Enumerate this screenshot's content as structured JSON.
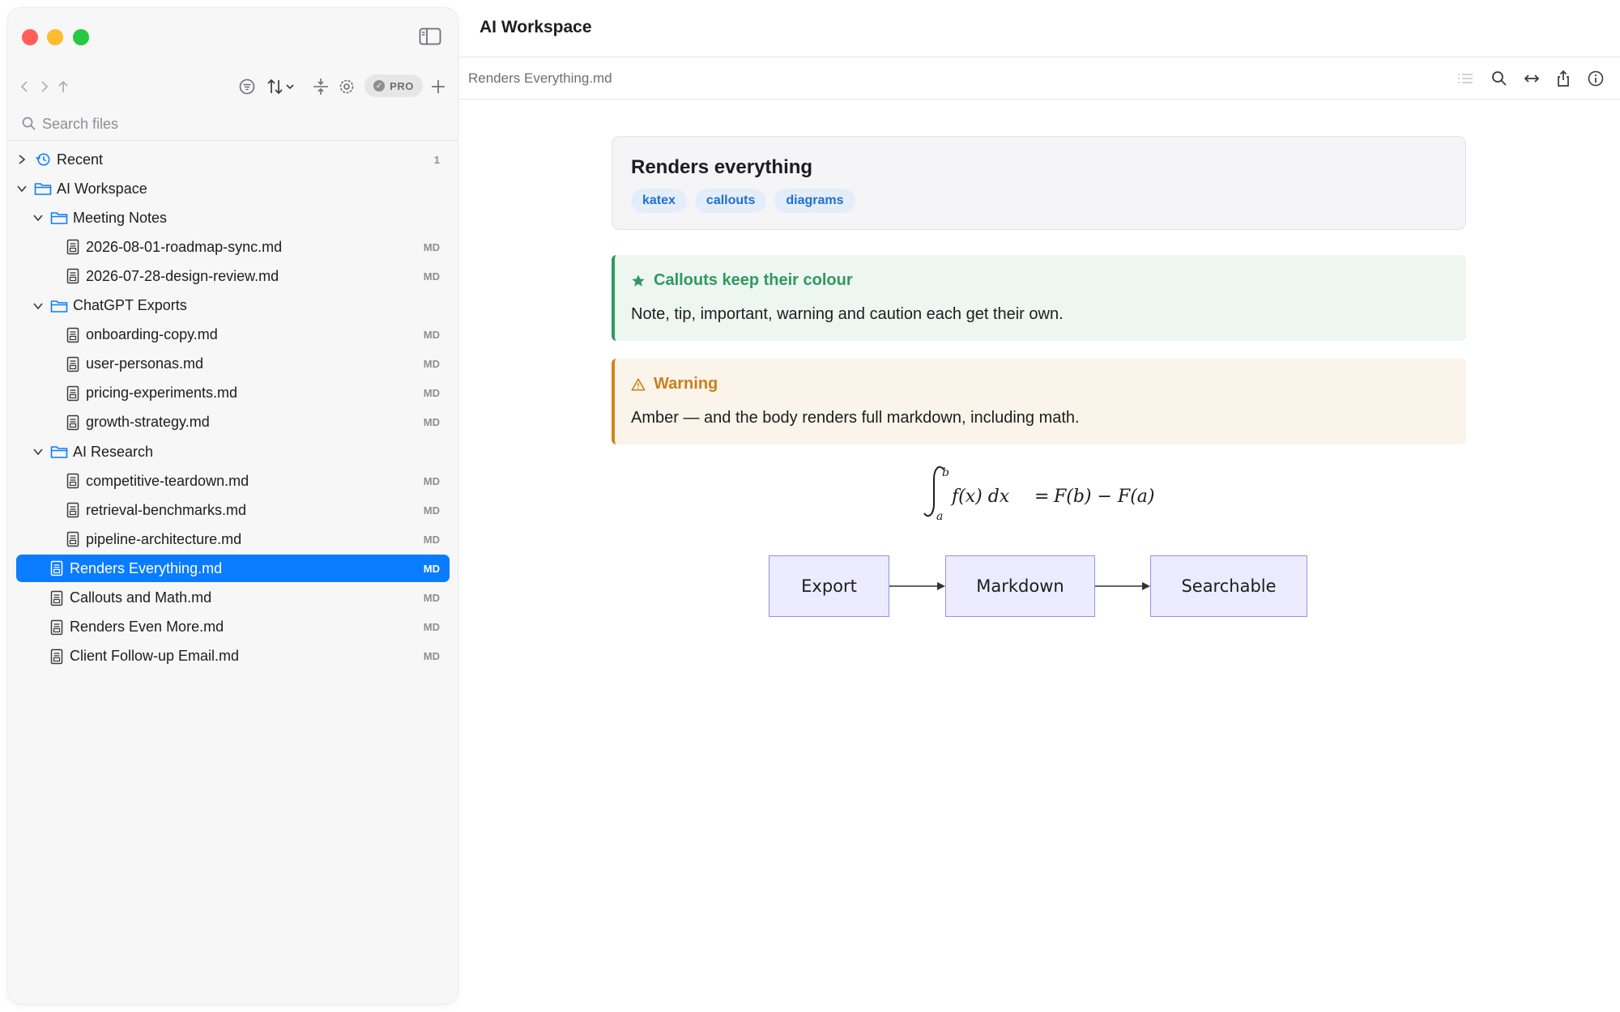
{
  "window": {
    "title": "AI Workspace",
    "traffic_lights": [
      "close",
      "minimize",
      "zoom"
    ]
  },
  "sidebar": {
    "toolbar": {
      "icons": [
        "back-icon",
        "forward-icon",
        "up-icon",
        "filter-icon",
        "sort-icon",
        "collapse-icon",
        "gear-icon"
      ],
      "pro_label": "PRO",
      "add_icon": "plus-icon"
    },
    "search": {
      "placeholder": "Search files",
      "value": ""
    },
    "tree": [
      {
        "label": "Recent",
        "kind": "recent",
        "badge": "1"
      },
      {
        "label": "AI Workspace",
        "kind": "folder"
      },
      {
        "label": "Meeting Notes",
        "kind": "folder"
      },
      {
        "label": "2026-08-01-roadmap-sync.md",
        "kind": "file",
        "badge": "MD"
      },
      {
        "label": "2026-07-28-design-review.md",
        "kind": "file",
        "badge": "MD"
      },
      {
        "label": "ChatGPT Exports",
        "kind": "folder"
      },
      {
        "label": "onboarding-copy.md",
        "kind": "file",
        "badge": "MD"
      },
      {
        "label": "user-personas.md",
        "kind": "file",
        "badge": "MD"
      },
      {
        "label": "pricing-experiments.md",
        "kind": "file",
        "badge": "MD"
      },
      {
        "label": "growth-strategy.md",
        "kind": "file",
        "badge": "MD"
      },
      {
        "label": "AI Research",
        "kind": "folder"
      },
      {
        "label": "competitive-teardown.md",
        "kind": "file",
        "badge": "MD"
      },
      {
        "label": "retrieval-benchmarks.md",
        "kind": "file",
        "badge": "MD"
      },
      {
        "label": "pipeline-architecture.md",
        "kind": "file",
        "badge": "MD"
      },
      {
        "label": "Renders Everything.md",
        "kind": "file",
        "badge": "MD",
        "selected": true
      },
      {
        "label": "Callouts and Math.md",
        "kind": "file",
        "badge": "MD"
      },
      {
        "label": "Renders Even More.md",
        "kind": "file",
        "badge": "MD"
      },
      {
        "label": "Client Follow-up Email.md",
        "kind": "file",
        "badge": "MD"
      }
    ]
  },
  "main": {
    "title": "AI Workspace",
    "breadcrumb": "Renders Everything.md",
    "toolbar_icons": [
      "outline-icon",
      "search-icon",
      "width-toggle-icon",
      "share-icon",
      "info-icon"
    ],
    "document": {
      "front_title": "Renders everything",
      "tags": [
        "katex",
        "callouts",
        "diagrams"
      ],
      "callouts": [
        {
          "type": "tip",
          "icon": "star-icon",
          "title": "Callouts keep their colour",
          "body": "Note, tip, important, warning and caution each get their own."
        },
        {
          "type": "warning",
          "icon": "warning-icon",
          "title": "Warning",
          "body": "Amber — and the body renders full markdown, including math."
        }
      ],
      "math": {
        "lower": "a",
        "upper": "b",
        "integrand": "f(x) dx",
        "equals": "=",
        "result": "F(b) − F(a)"
      },
      "diagram": {
        "nodes": [
          "Export",
          "Markdown",
          "Searchable"
        ]
      }
    }
  },
  "colors": {
    "accent": "#0a7cff",
    "tip": "#2e9a5e",
    "warning": "#c9801a",
    "tag_text": "#1f6fd1",
    "node_fill": "#ecebff",
    "node_stroke": "#9b8fe0"
  }
}
